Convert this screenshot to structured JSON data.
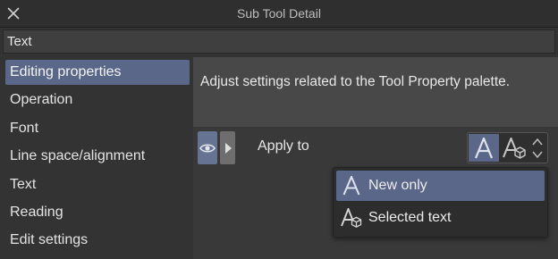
{
  "window": {
    "title": "Sub Tool Detail",
    "close_icon": "close-icon",
    "tool_name": "Text"
  },
  "sidebar": {
    "items": [
      {
        "label": "Editing properties",
        "active": true
      },
      {
        "label": "Operation",
        "active": false
      },
      {
        "label": "Font",
        "active": false
      },
      {
        "label": "Line space/alignment",
        "active": false
      },
      {
        "label": "Text",
        "active": false
      },
      {
        "label": "Reading",
        "active": false
      },
      {
        "label": "Edit settings",
        "active": false
      }
    ]
  },
  "main": {
    "description": "Adjust settings related to the Tool Property palette.",
    "apply_to": {
      "label": "Apply to",
      "eye_icon": "eye-icon",
      "expand_icon": "play-arrow-icon",
      "current_mode_icon": "text-a-icon",
      "alt_mode_icon": "selected-text-icon",
      "stepper_icon": "chevron-updown-icon"
    },
    "dropdown": {
      "options": [
        {
          "label": "New only",
          "icon": "text-a-icon",
          "selected": true
        },
        {
          "label": "Selected text",
          "icon": "selected-text-icon",
          "selected": false
        }
      ]
    }
  },
  "colors": {
    "accent": "#5a6788",
    "background": "#333333",
    "panel": "#484848"
  }
}
